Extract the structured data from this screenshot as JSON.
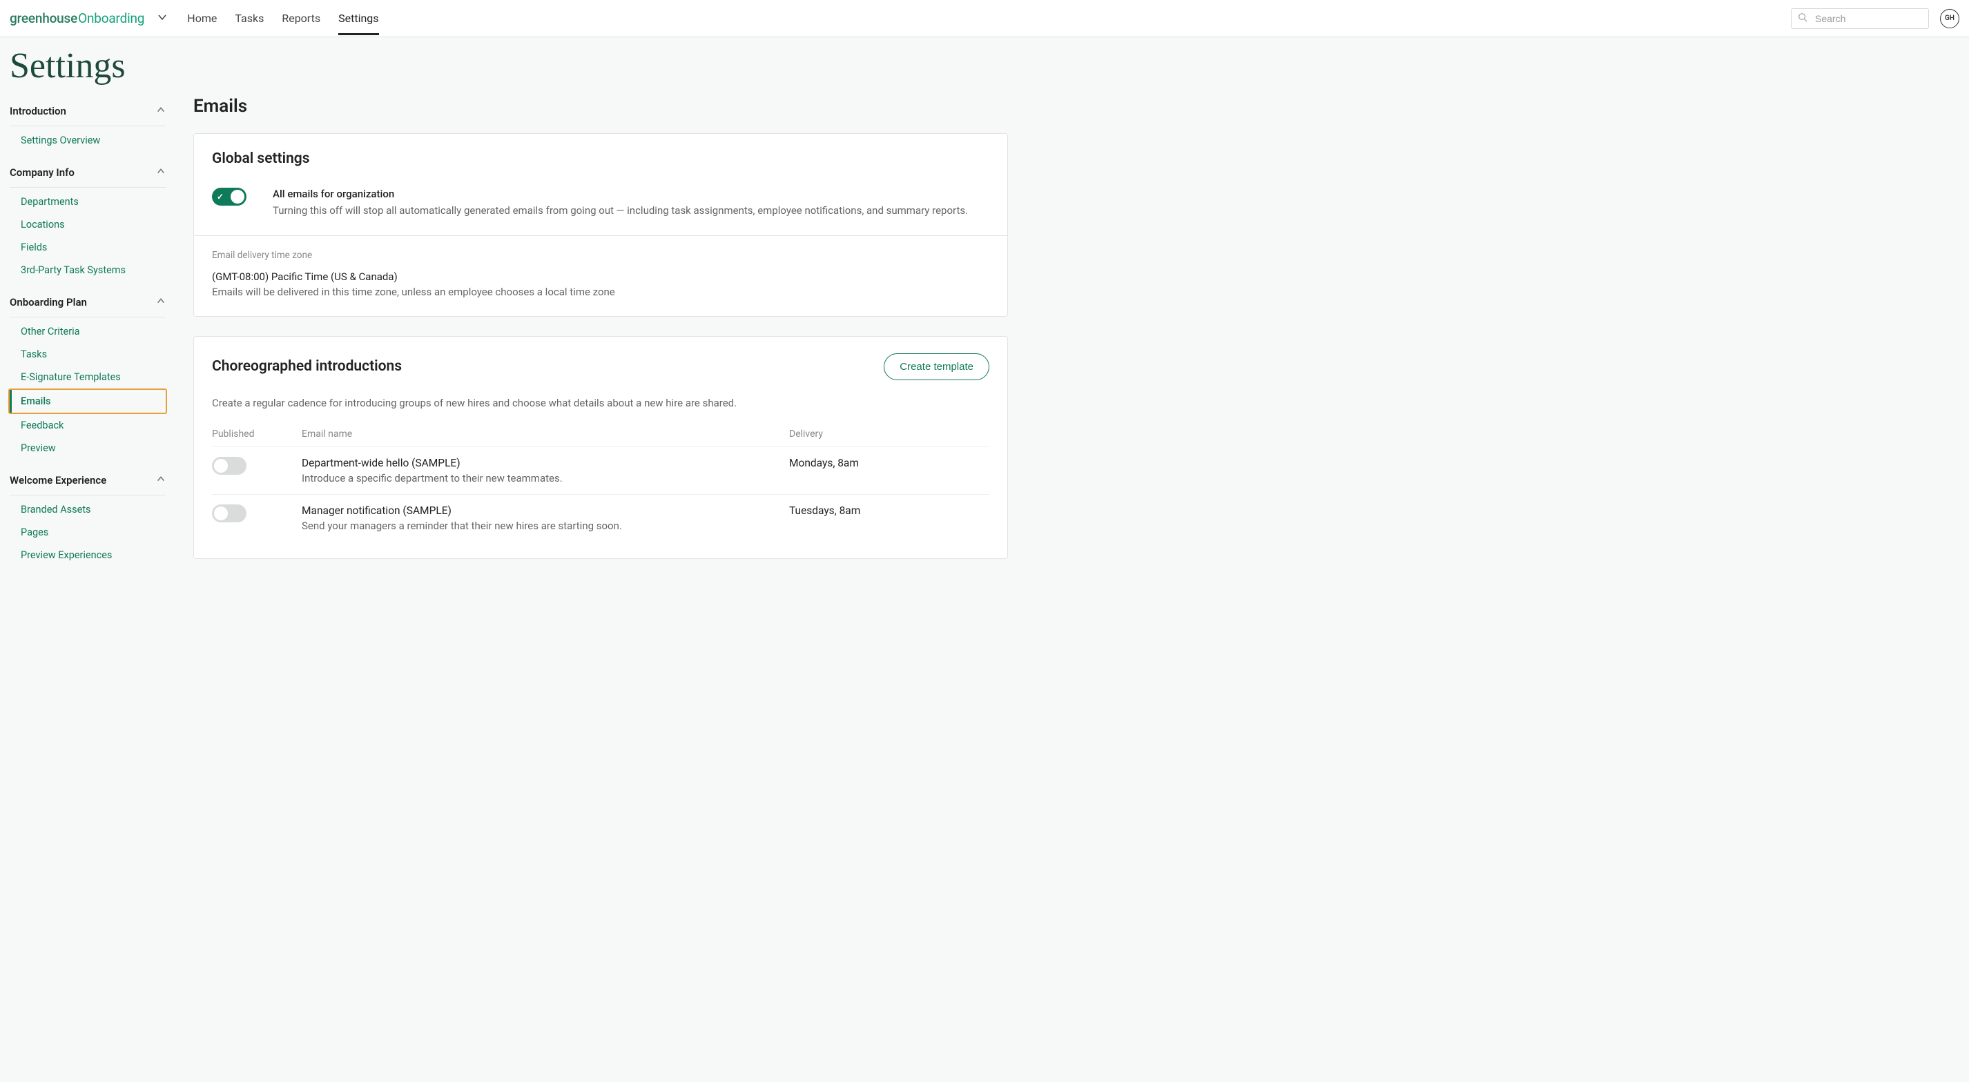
{
  "header": {
    "logo1": "greenhouse",
    "logo2": "Onboarding",
    "nav": {
      "home": "Home",
      "tasks": "Tasks",
      "reports": "Reports",
      "settings": "Settings"
    },
    "search_placeholder": "Search",
    "avatar": "GH"
  },
  "page_title": "Settings",
  "sidebar": {
    "groups": [
      {
        "title": "Introduction",
        "items": [
          "Settings Overview"
        ]
      },
      {
        "title": "Company Info",
        "items": [
          "Departments",
          "Locations",
          "Fields",
          "3rd-Party Task Systems"
        ]
      },
      {
        "title": "Onboarding Plan",
        "items": [
          "Other Criteria",
          "Tasks",
          "E-Signature Templates",
          "Emails",
          "Feedback",
          "Preview"
        ]
      },
      {
        "title": "Welcome Experience",
        "items": [
          "Branded Assets",
          "Pages",
          "Preview Experiences"
        ]
      }
    ]
  },
  "main": {
    "heading": "Emails",
    "global": {
      "title": "Global settings",
      "all_emails_title": "All emails for organization",
      "all_emails_desc": "Turning this off will stop all automatically generated emails from going out — including task assignments, employee notifications, and summary reports.",
      "tz_label": "Email delivery time zone",
      "tz_value": "(GMT-08:00) Pacific Time (US & Canada)",
      "tz_desc": "Emails will be delivered in this time zone, unless an employee chooses a local time zone"
    },
    "choreo": {
      "title": "Choreographed introductions",
      "create_button": "Create template",
      "desc": "Create a regular cadence for introducing groups of new hires and choose what details about a new hire are shared.",
      "columns": {
        "published": "Published",
        "name": "Email name",
        "delivery": "Delivery"
      },
      "rows": [
        {
          "title": "Department-wide hello (SAMPLE)",
          "desc": "Introduce a specific department to their new teammates.",
          "delivery": "Mondays, 8am"
        },
        {
          "title": "Manager notification (SAMPLE)",
          "desc": "Send your managers a reminder that their new hires are starting soon.",
          "delivery": "Tuesdays, 8am"
        }
      ]
    }
  }
}
